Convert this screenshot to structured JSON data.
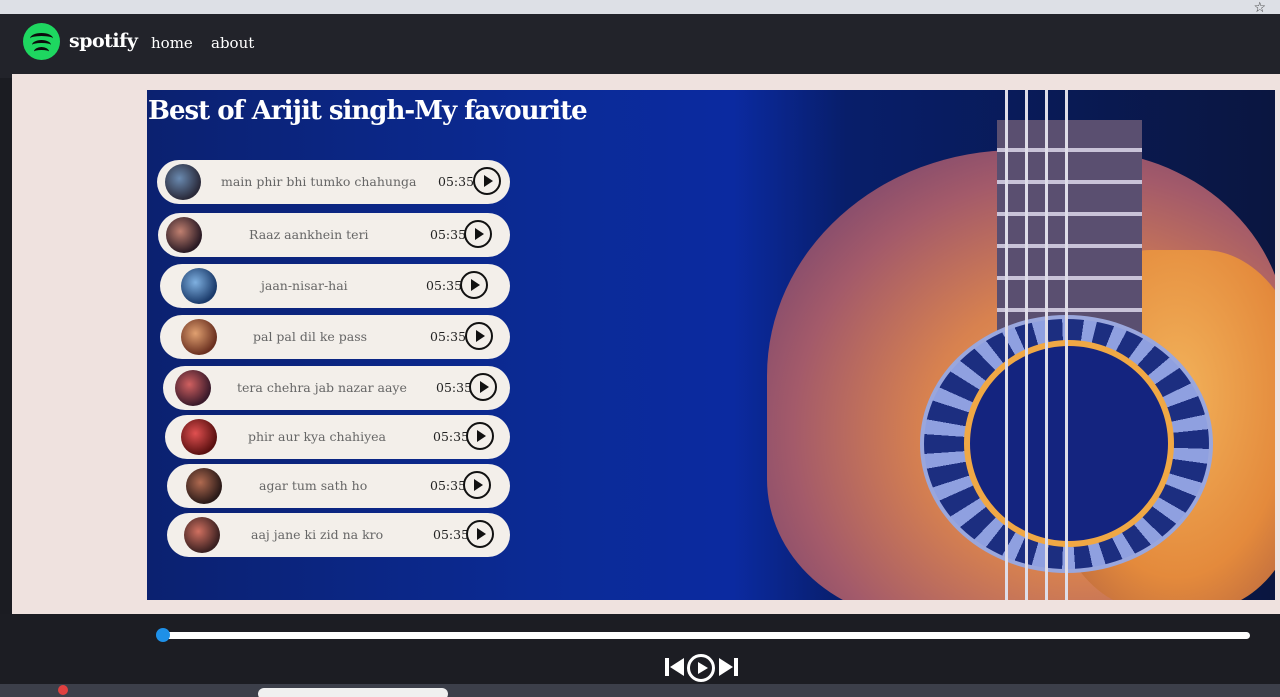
{
  "navbar": {
    "brand": "spotify",
    "links": [
      "home",
      "about"
    ]
  },
  "hero": {
    "title": "Best of Arijit singh-My favourite"
  },
  "songs": [
    {
      "title": "main phir bhi tumko chahunga",
      "duration": "05:35"
    },
    {
      "title": "Raaz aankhein teri",
      "duration": "05:35"
    },
    {
      "title": "jaan-nisar-hai",
      "duration": "05:35"
    },
    {
      "title": "pal pal dil ke pass",
      "duration": "05:35"
    },
    {
      "title": "tera chehra jab nazar aaye",
      "duration": "05:35"
    },
    {
      "title": "phir aur kya chahiyea",
      "duration": "05:35"
    },
    {
      "title": "agar tum sath ho",
      "duration": "05:35"
    },
    {
      "title": "aaj jane ki zid na kro",
      "duration": "05:35"
    }
  ],
  "player": {
    "progress": 0
  },
  "colors": {
    "brand_green": "#1ed760",
    "progress_thumb": "#1e90e8",
    "navbar_bg": "#22232a"
  }
}
